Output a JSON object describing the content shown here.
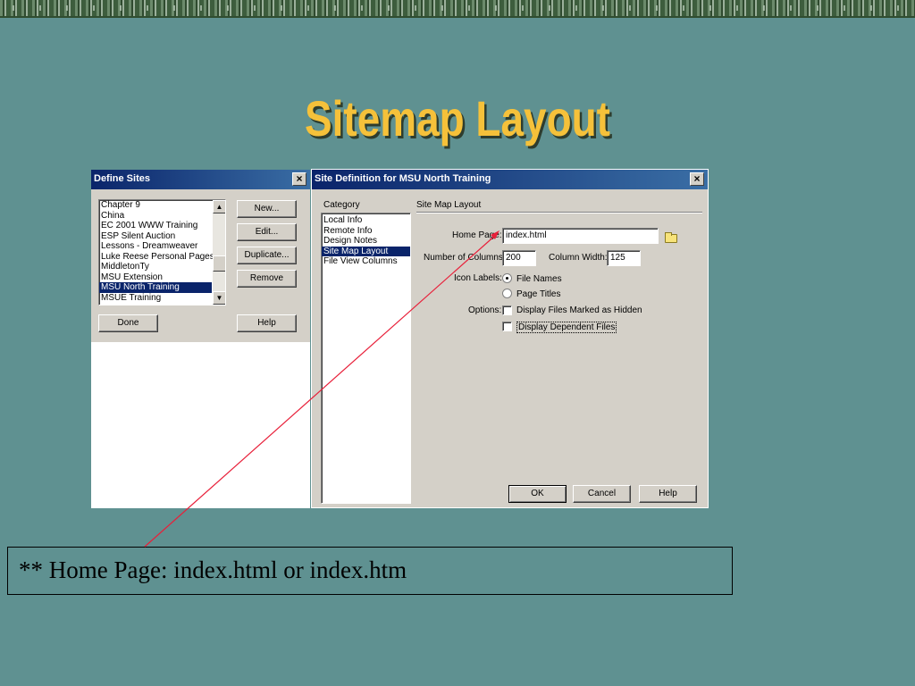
{
  "slide": {
    "title": "Sitemap Layout",
    "callout": "** Home Page: index.html or index.htm"
  },
  "define_sites": {
    "title": "Define Sites",
    "close": "×",
    "sites": [
      "Chapter 9",
      "China",
      "EC 2001 WWW Training",
      "ESP Silent Auction",
      "Lessons - Dreamweaver",
      "Luke Reese Personal Pages",
      "MiddletonTy",
      "MSU Extension",
      "MSU North Training",
      "MSUE Training"
    ],
    "selected_site": "MSU North Training",
    "buttons": {
      "new": "New...",
      "edit": "Edit...",
      "duplicate": "Duplicate...",
      "remove": "Remove",
      "done": "Done",
      "help": "Help"
    },
    "scroll_up": "▲",
    "scroll_down": "▼"
  },
  "site_definition": {
    "title": "Site Definition for MSU North Training",
    "close": "×",
    "category_label": "Category",
    "categories": [
      "Local Info",
      "Remote Info",
      "Design Notes",
      "Site Map Layout",
      "File View Columns"
    ],
    "selected_category": "Site Map Layout",
    "panel_title": "Site Map Layout",
    "home_page_label": "Home Page:",
    "home_page_value": "index.html",
    "num_columns_label": "Number of Columns:",
    "num_columns_value": "200",
    "column_width_label": "Column Width:",
    "column_width_value": "125",
    "icon_labels_label": "Icon Labels:",
    "icon_label_options": [
      "File Names",
      "Page Titles"
    ],
    "icon_label_selected": "File Names",
    "options_label": "Options:",
    "option_hidden": "Display Files Marked as Hidden",
    "option_dependent": "Display Dependent Files",
    "buttons": {
      "ok": "OK",
      "cancel": "Cancel",
      "help": "Help"
    }
  },
  "colors": {
    "background": "#5f9191",
    "title": "#f5c13a",
    "titlebar": "#0a246a",
    "selection": "#0a246a",
    "arrow": "#e8203a"
  }
}
